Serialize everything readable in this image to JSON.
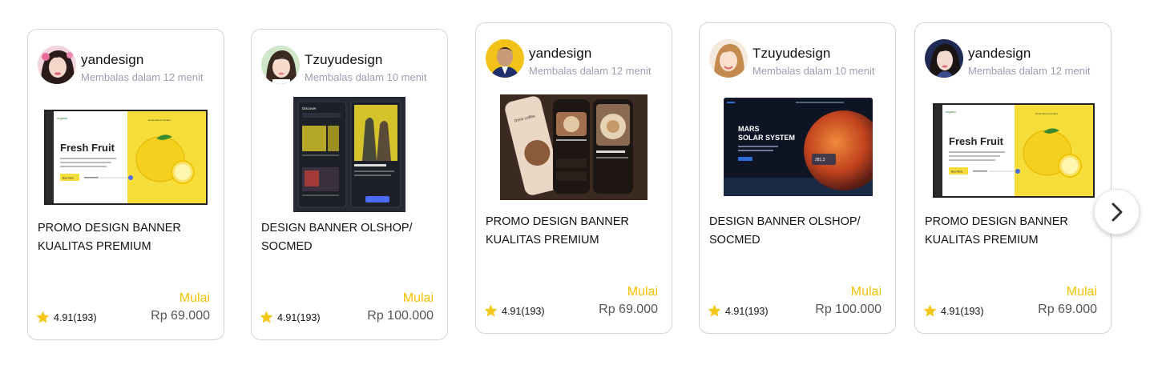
{
  "cards": [
    {
      "seller": "yandesign",
      "reply": "Membalas dalam 12 menit",
      "image": "fresh-fruit-banner",
      "image_text": {
        "headline": "Fresh Fruit",
        "brand": "organic",
        "cta": "Buy Now"
      },
      "title": "PROMO DESIGN  BANNER\nKUALITAS PREMIUM",
      "rating": "4.91(193)",
      "start_label": "Mulai",
      "price": "Rp 69.000"
    },
    {
      "seller": "Tzuyudesign",
      "reply": "Membalas dalam 10 menit",
      "image": "game-app-mockup",
      "image_text": {
        "headline": "Discover"
      },
      "title": " DESIGN  BANNER OLSHOP/\nSOCMED",
      "rating": "4.91(193)",
      "start_label": "Mulai",
      "price": "Rp 100.000"
    },
    {
      "seller": "yandesign",
      "reply": "Membalas dalam 12 menit",
      "image": "coffee-app-mockup",
      "image_text": {
        "headline": "Drink coffee"
      },
      "title": "PROMO DESIGN  BANNER\nKUALITAS PREMIUM",
      "rating": "4.91(193)",
      "start_label": "Mulai",
      "price": "Rp 69.000"
    },
    {
      "seller": "Tzuyudesign",
      "reply": "Membalas dalam 10 menit",
      "image": "mars-solar-system",
      "image_text": {
        "headline": "MARS",
        "subhead": "SOLAR SYSTEM"
      },
      "title": " DESIGN  BANNER OLSHOP/\nSOCMED",
      "rating": "4.91(193)",
      "start_label": "Mulai",
      "price": "Rp 100.000"
    },
    {
      "seller": "yandesign",
      "reply": "Membalas dalam 12 menit",
      "image": "fresh-fruit-banner",
      "image_text": {
        "headline": "Fresh Fruit",
        "brand": "organic",
        "cta": "Buy Now"
      },
      "title": "PROMO DESIGN  BANNER\nKUALITAS PREMIUM",
      "rating": "4.91(193)",
      "start_label": "Mulai",
      "price": "Rp 69.000"
    }
  ],
  "next_button": {
    "icon": "chevron-right-icon"
  },
  "colors": {
    "accent": "#f2c200",
    "star": "#f5c518",
    "muted": "#9a9fb0"
  }
}
